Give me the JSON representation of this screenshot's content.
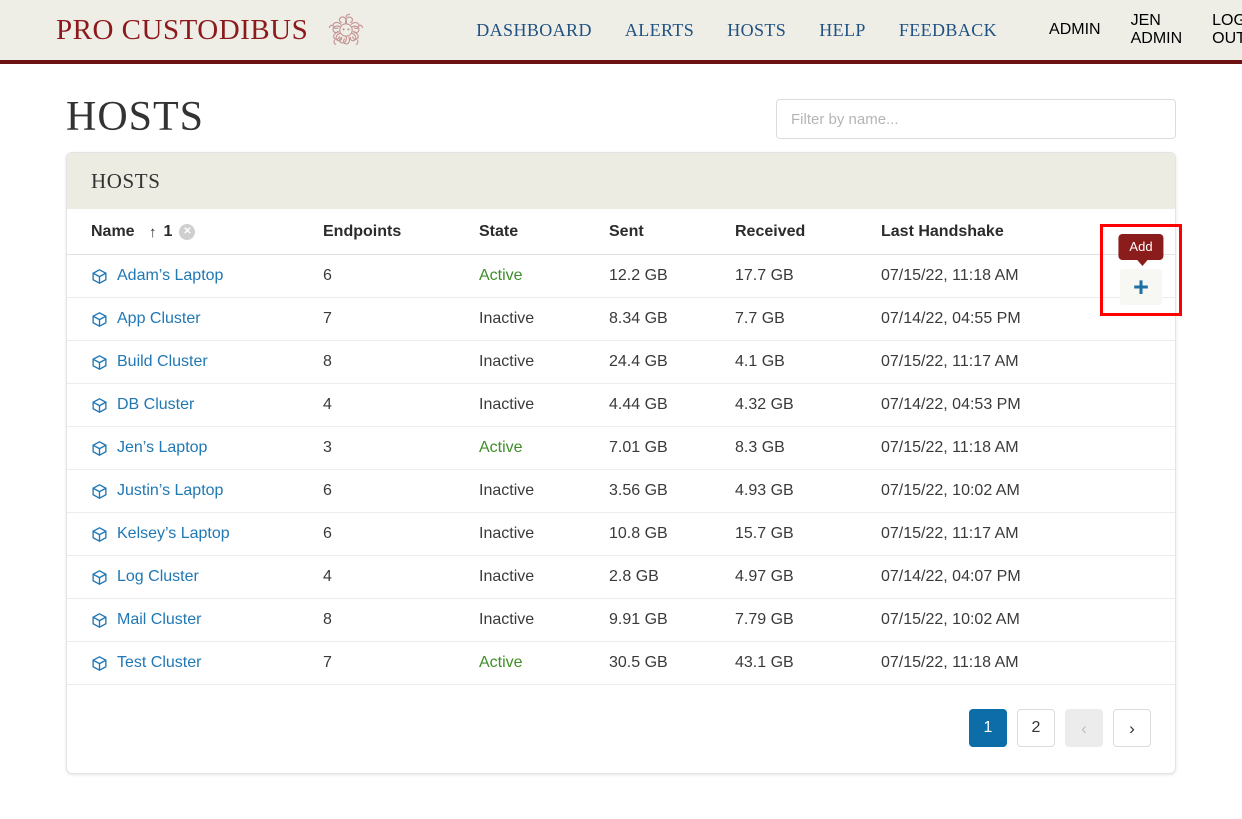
{
  "header": {
    "brand": "PRO CUSTODIBUS",
    "emblem_icon": "medusa-emblem-icon",
    "nav": [
      {
        "label": "DASHBOARD"
      },
      {
        "label": "ALERTS"
      },
      {
        "label": "HOSTS"
      },
      {
        "label": "HELP"
      },
      {
        "label": "FEEDBACK"
      }
    ],
    "user_nav": [
      {
        "label": "ADMIN"
      },
      {
        "label": "JEN ADMIN"
      },
      {
        "label": "LOG OUT"
      }
    ]
  },
  "page": {
    "title": "HOSTS",
    "filter": {
      "value": "",
      "placeholder": "Filter by name..."
    },
    "add": {
      "tooltip": "Add",
      "icon": "plus-icon"
    }
  },
  "card": {
    "title": "HOSTS",
    "columns": [
      {
        "label": "Name",
        "sort": {
          "direction_icon": "↑",
          "order": "1",
          "clear_icon": "circle-x-icon"
        }
      },
      {
        "label": "Endpoints"
      },
      {
        "label": "State"
      },
      {
        "label": "Sent"
      },
      {
        "label": "Received"
      },
      {
        "label": "Last Handshake"
      }
    ],
    "rows": [
      {
        "icon": "cube-icon",
        "name": "Adam’s Laptop",
        "endpoints": "6",
        "state": "Active",
        "sent": "12.2 GB",
        "received": "17.7 GB",
        "last_handshake": "07/15/22, 11:18 AM"
      },
      {
        "icon": "cube-icon",
        "name": "App Cluster",
        "endpoints": "7",
        "state": "Inactive",
        "sent": "8.34 GB",
        "received": "7.7 GB",
        "last_handshake": "07/14/22, 04:55 PM"
      },
      {
        "icon": "cube-icon",
        "name": "Build Cluster",
        "endpoints": "8",
        "state": "Inactive",
        "sent": "24.4 GB",
        "received": "4.1 GB",
        "last_handshake": "07/15/22, 11:17 AM"
      },
      {
        "icon": "cube-icon",
        "name": "DB Cluster",
        "endpoints": "4",
        "state": "Inactive",
        "sent": "4.44 GB",
        "received": "4.32 GB",
        "last_handshake": "07/14/22, 04:53 PM"
      },
      {
        "icon": "cube-icon",
        "name": "Jen’s Laptop",
        "endpoints": "3",
        "state": "Active",
        "sent": "7.01 GB",
        "received": "8.3 GB",
        "last_handshake": "07/15/22, 11:18 AM"
      },
      {
        "icon": "cube-icon",
        "name": "Justin’s Laptop",
        "endpoints": "6",
        "state": "Inactive",
        "sent": "3.56 GB",
        "received": "4.93 GB",
        "last_handshake": "07/15/22, 10:02 AM"
      },
      {
        "icon": "cube-icon",
        "name": "Kelsey’s Laptop",
        "endpoints": "6",
        "state": "Inactive",
        "sent": "10.8 GB",
        "received": "15.7 GB",
        "last_handshake": "07/15/22, 11:17 AM"
      },
      {
        "icon": "cube-icon",
        "name": "Log Cluster",
        "endpoints": "4",
        "state": "Inactive",
        "sent": "2.8 GB",
        "received": "4.97 GB",
        "last_handshake": "07/14/22, 04:07 PM"
      },
      {
        "icon": "cube-icon",
        "name": "Mail Cluster",
        "endpoints": "8",
        "state": "Inactive",
        "sent": "9.91 GB",
        "received": "7.79 GB",
        "last_handshake": "07/15/22, 10:02 AM"
      },
      {
        "icon": "cube-icon",
        "name": "Test Cluster",
        "endpoints": "7",
        "state": "Active",
        "sent": "30.5 GB",
        "received": "43.1 GB",
        "last_handshake": "07/15/22, 11:18 AM"
      }
    ]
  },
  "pagination": {
    "pages": [
      {
        "label": "1",
        "state": "active"
      },
      {
        "label": "2",
        "state": "default"
      }
    ],
    "prev": {
      "label": "‹",
      "icon": "chevron-left-icon",
      "state": "disabled"
    },
    "next": {
      "label": "›",
      "icon": "chevron-right-icon",
      "state": "default"
    }
  },
  "colors": {
    "brand_red": "#8c1a1c",
    "header_rule": "#6d1214",
    "link_blue": "#2078b4",
    "nav_blue": "#1f5182",
    "active_green": "#3f8f29",
    "pager_active": "#0c6da8",
    "highlight_red": "#fe0000",
    "tooltip_bg": "#8b1c1c",
    "header_bg": "#eeeee7",
    "card_header_bg": "#edece3"
  }
}
